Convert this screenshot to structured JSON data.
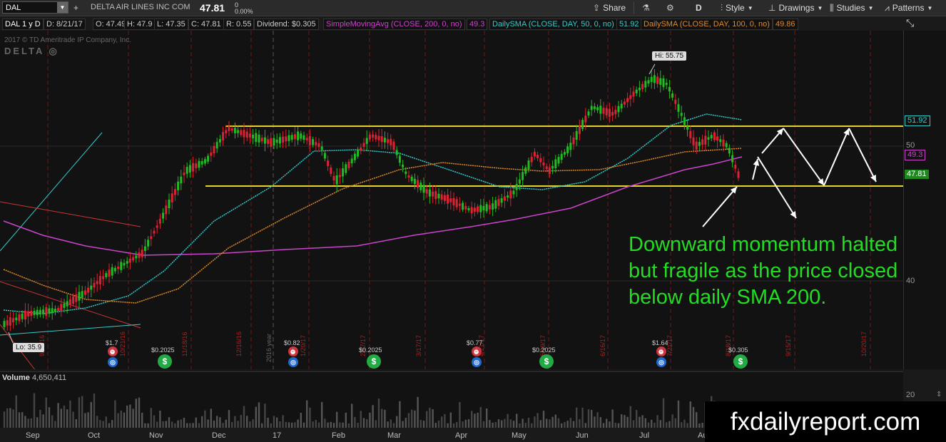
{
  "toolbar": {
    "symbol": "DAL",
    "company": "DELTA AIR LINES INC COM",
    "last": "47.81",
    "change_pct": "0.00%",
    "change_abs": "0",
    "share": "Share",
    "style": "Style",
    "drawings": "Drawings",
    "studies": "Studies",
    "patterns": "Patterns",
    "aggregation": "D"
  },
  "studybar": {
    "period": "DAL 1 y D",
    "date": "D: 8/21/17",
    "open": "O: 47.49",
    "high": "H: 47.9",
    "low": "L: 47.35",
    "close": "C: 47.81",
    "range": "R: 0.55",
    "dividend": "Dividend: $0.305",
    "sma200": "SimpleMovingAvg (CLOSE, 200, 0, no)",
    "sma200_val": "49.3",
    "sma50": "DailySMA (CLOSE, DAY, 50, 0, no)",
    "sma50_val": "51.92",
    "sma100": "DailySMA (CLOSE, DAY, 100, 0, no)",
    "sma100_val": "49.86"
  },
  "chart": {
    "copyright": "2017 © TD Ameritrade IP Company, Inc.",
    "logo": "DELTA",
    "hi_label": "Hi: 55.75",
    "lo_label": "Lo: 35.9",
    "year_label": "2016 year",
    "colors": {
      "sma200": "#cc44cc",
      "sma50": "#33cccc",
      "sma100": "#e08a2a",
      "support": "#e6d22a",
      "up": "#22bb22",
      "down": "#dd2233",
      "arrows": "#ffffff"
    }
  },
  "yaxis": {
    "labels": [
      "50",
      "40",
      "20"
    ],
    "tag_sma50": "51.92",
    "tag_sma200": "49.3",
    "tag_last": "47.81"
  },
  "volume": {
    "label": "Volume",
    "value": "4,650,411"
  },
  "xaxis": {
    "labels": [
      "Sep",
      "Oct",
      "Nov",
      "Dec",
      "17",
      "Feb",
      "Mar",
      "Apr",
      "May",
      "Jun",
      "Jul",
      "Au"
    ]
  },
  "events": {
    "e1": "$1.7",
    "e2": "$0.2025",
    "e3": "$0.82",
    "e4": "$0.2025",
    "e5": "$0.77",
    "e6": "$0.2025",
    "e7": "$1.64",
    "e8": "$0.305"
  },
  "dates": [
    "9/16/16",
    "10/21/16",
    "11/18/16",
    "12/16/16",
    "1/20/17",
    "2/17/17",
    "3/17/17",
    "4/21/17",
    "5/19/17",
    "6/16/17",
    "7/21/17",
    "8/18/17",
    "9/15/17",
    "10/20/17"
  ],
  "annotation": {
    "line1": "Downward momentum halted",
    "line2": "but fragile as the price closed",
    "line3": "below daily SMA 200."
  },
  "watermark": "fxdailyreport.com"
}
